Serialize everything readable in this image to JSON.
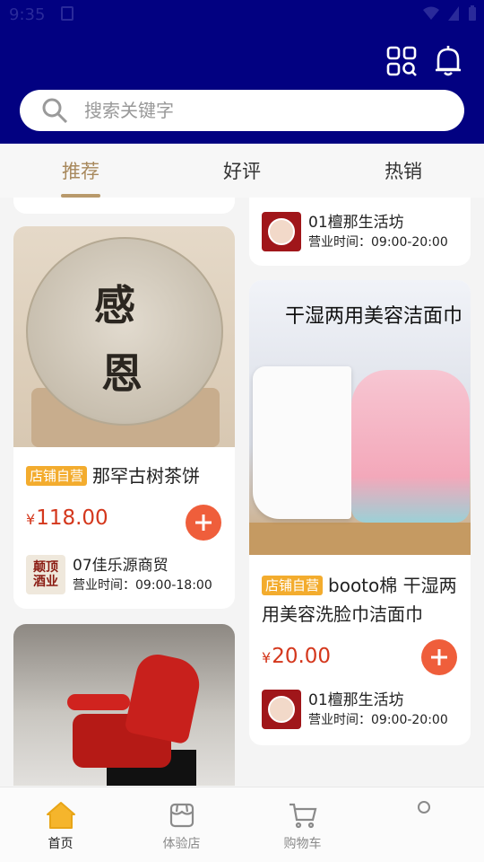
{
  "status_bar": {
    "time": "9:35"
  },
  "search": {
    "placeholder": "搜索关键字"
  },
  "tabs": [
    {
      "label": "推荐",
      "active": true
    },
    {
      "label": "好评",
      "active": false
    },
    {
      "label": "热销",
      "active": false
    }
  ],
  "products": [
    {
      "badge": "店铺自营",
      "title": "那罕古树茶饼",
      "currency": "¥",
      "price": "118.00",
      "shop_name": "07佳乐源商贸",
      "shop_hours": "营业时间：09:00-18:00",
      "shop_logo_text": [
        "颠顶",
        "酒业"
      ],
      "image_text": [
        "感",
        "恩"
      ]
    },
    {
      "badge": "店铺自营",
      "title": "booto棉 干湿两用美容洗脸巾洁面巾",
      "currency": "¥",
      "price": "20.00",
      "shop_name": "01檀那生活坊",
      "shop_hours": "营业时间：09:00-20:00",
      "image_text": "干湿两用美容洁面巾"
    }
  ],
  "partial_card_top": {
    "shop_name": "01檀那生活坊",
    "shop_hours": "营业时间：09:00-20:00"
  },
  "bottom_nav": [
    {
      "label": "首页",
      "active": true
    },
    {
      "label": "体验店",
      "active": false
    },
    {
      "label": "购物车",
      "active": false
    },
    {
      "label": "",
      "active": false
    }
  ],
  "colors": {
    "header": "#020181",
    "accent": "#a8895d",
    "price": "#d4371c",
    "badge": "#f3ac2e",
    "add_button": "#ef5e3b"
  }
}
